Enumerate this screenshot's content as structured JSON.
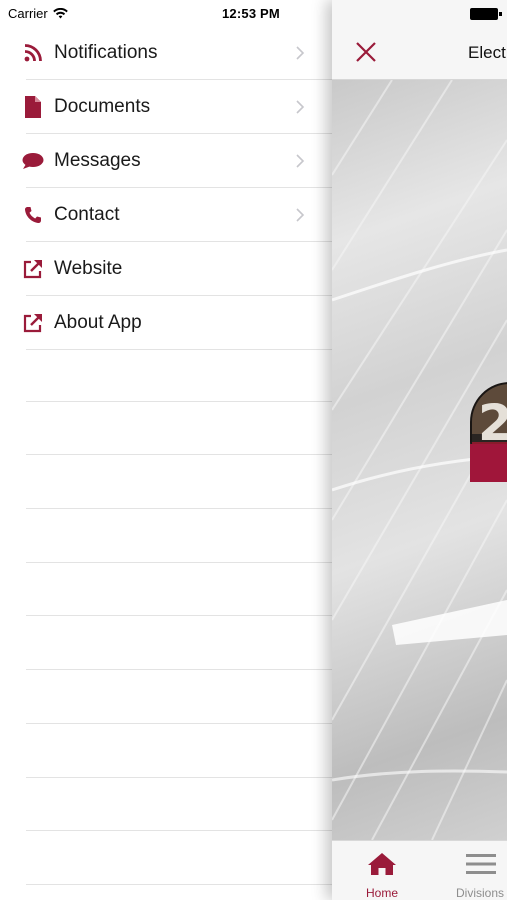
{
  "status_bar": {
    "carrier": "Carrier",
    "time": "12:53 PM"
  },
  "colors": {
    "accent": "#9a1b3a",
    "text": "#1a1a1a",
    "divider": "#e3e3e3",
    "chevron": "#c7c7cc",
    "tab_inactive": "#8e8e8e"
  },
  "menu": {
    "items": [
      {
        "label": "Notifications",
        "icon": "rss-icon",
        "has_chevron": true
      },
      {
        "label": "Documents",
        "icon": "document-icon",
        "has_chevron": true
      },
      {
        "label": "Messages",
        "icon": "chat-bubble-icon",
        "has_chevron": true
      },
      {
        "label": "Contact",
        "icon": "phone-icon",
        "has_chevron": true
      },
      {
        "label": "Website",
        "icon": "external-link-icon",
        "has_chevron": false
      },
      {
        "label": "About App",
        "icon": "external-link-icon",
        "has_chevron": false
      }
    ]
  },
  "main": {
    "nav_title": "Elect",
    "close_icon": "close-icon",
    "logo_text": "2"
  },
  "tabbar": {
    "tabs": [
      {
        "label": "Home",
        "icon": "home-icon",
        "active": true
      },
      {
        "label": "Divisions",
        "icon": "hamburger-icon",
        "active": false
      }
    ]
  }
}
